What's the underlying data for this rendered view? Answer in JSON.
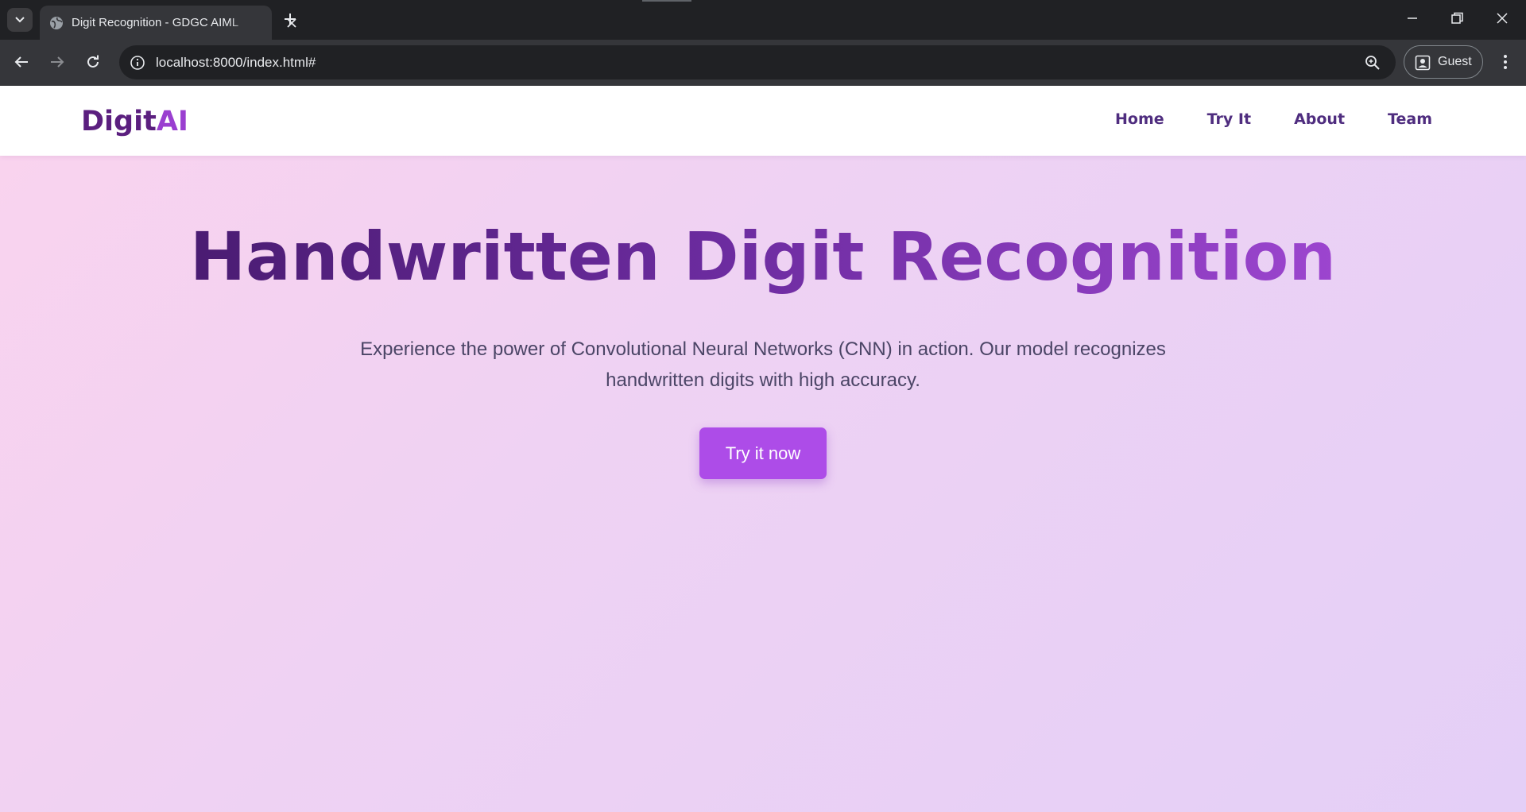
{
  "browser": {
    "tab_title": "Digit Recognition - GDGC AIML",
    "url": "localhost:8000/index.html#",
    "profile_label": "Guest"
  },
  "page": {
    "logo": {
      "part1": "Digit",
      "part2": "AI",
      "part1_color": "#5b1f7f",
      "part2_color": "#9a3fd0"
    },
    "nav": [
      {
        "label": "Home"
      },
      {
        "label": "Try It"
      },
      {
        "label": "About"
      },
      {
        "label": "Team"
      }
    ],
    "hero": {
      "title": "Handwritten Digit Recognition",
      "subtitle": "Experience the power of Convolutional Neural Networks (CNN) in action. Our model recognizes handwritten digits with high accuracy.",
      "cta_label": "Try it now"
    },
    "colors": {
      "accent": "#ad4ce8",
      "nav_text": "#4f2d7f",
      "background_start": "#fad3ee",
      "background_end": "#e4cff7"
    }
  }
}
